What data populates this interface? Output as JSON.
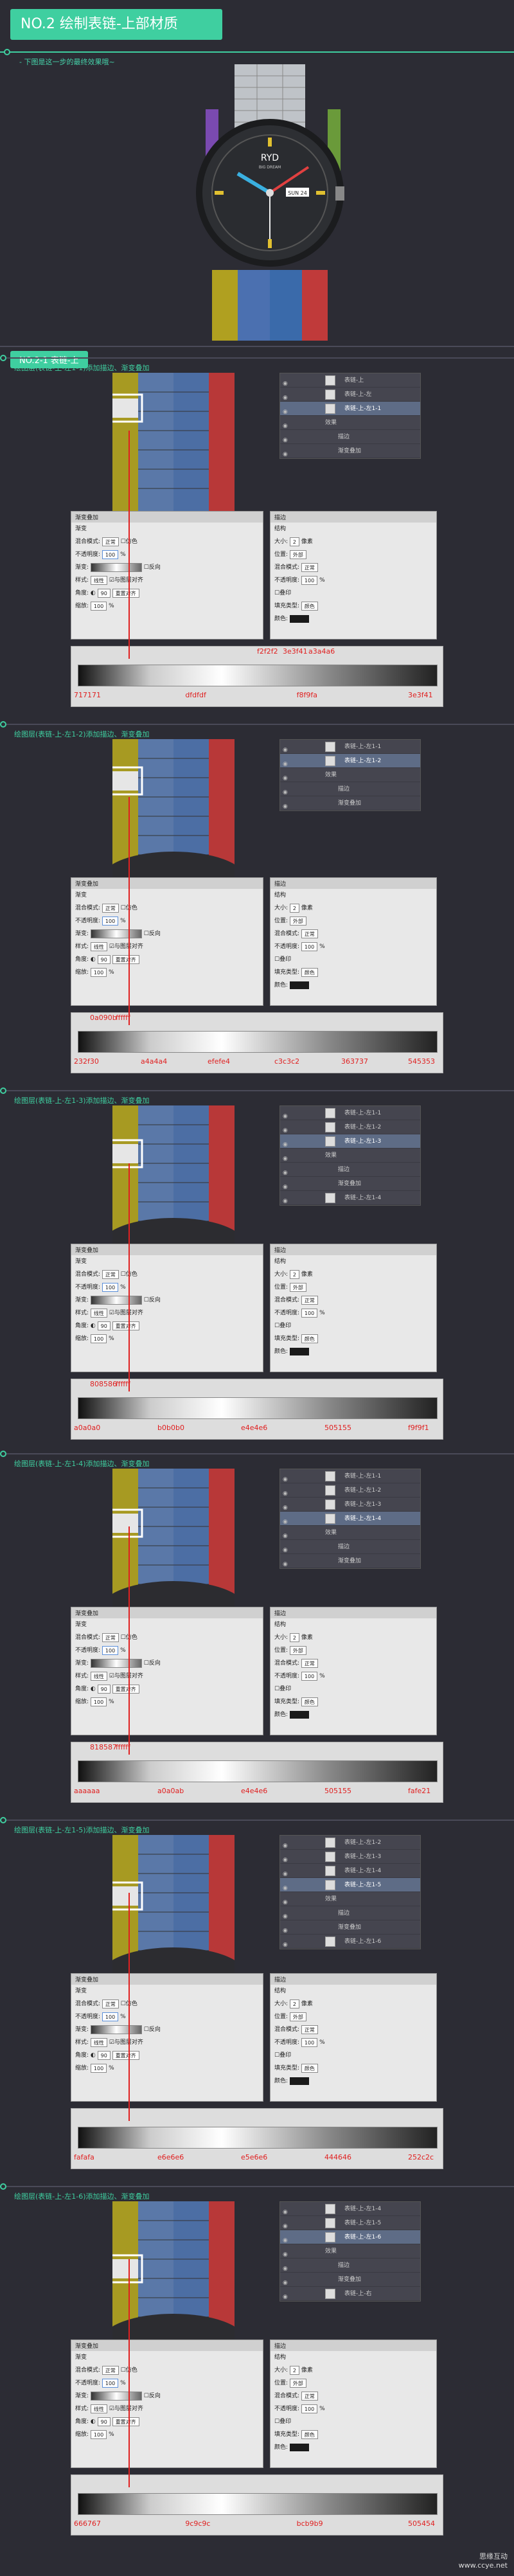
{
  "header": {
    "title": "NO.2 绘制表链-上部材质",
    "subtitle": "- 下图是这一步的最终效果哦~"
  },
  "section": {
    "tag": "NO.2-1 表链-上"
  },
  "watch": {
    "brand": "RYD",
    "sub": "BIG DREAM",
    "date": "SUN 24"
  },
  "steps": [
    {
      "label": "绘图层(表链-上-左1-1)添加描边、渐变叠加",
      "layers": [
        "表链-上",
        "表链-上-左",
        "表链-上-左1-1",
        "效果",
        "描边",
        "渐变叠加"
      ],
      "stopsTop": [
        "f2f2f2",
        "3e3f41",
        "a3a4a6"
      ],
      "stopsBottom": [
        "717171",
        "dfdfdf",
        "f8f9fa",
        "3e3f41"
      ]
    },
    {
      "label": "绘图层(表链-上-左1-2)添加描边、渐变叠加",
      "layers": [
        "表链-上-左1-1",
        "表链-上-左1-2",
        "效果",
        "描边",
        "渐变叠加"
      ],
      "stopsTop": [
        "0a090b",
        "ffffff"
      ],
      "stopsBottom": [
        "232f30",
        "a4a4a4",
        "efefe4",
        "c3c3c2",
        "363737",
        "545353"
      ]
    },
    {
      "label": "绘图层(表链-上-左1-3)添加描边、渐变叠加",
      "layers": [
        "表链-上-左1-1",
        "表链-上-左1-2",
        "表链-上-左1-3",
        "效果",
        "描边",
        "渐变叠加",
        "表链-上-左1-4"
      ],
      "stopsTop": [
        "808586",
        "ffffff"
      ],
      "stopsBottom": [
        "a0a0a0",
        "b0b0b0",
        "e4e4e6",
        "505155",
        "f9f9f1"
      ]
    },
    {
      "label": "绘图层(表链-上-左1-4)添加描边、渐变叠加",
      "layers": [
        "表链-上-左1-1",
        "表链-上-左1-2",
        "表链-上-左1-3",
        "表链-上-左1-4",
        "效果",
        "描边",
        "渐变叠加"
      ],
      "stopsTop": [
        "818587",
        "ffffff"
      ],
      "stopsBottom": [
        "aaaaaa",
        "a0a0ab",
        "e4e4e6",
        "505155",
        "fafe21"
      ]
    },
    {
      "label": "绘图层(表链-上-左1-5)添加描边、渐变叠加",
      "layers": [
        "表链-上-左1-2",
        "表链-上-左1-3",
        "表链-上-左1-4",
        "表链-上-左1-5",
        "效果",
        "描边",
        "渐变叠加",
        "表链-上-左1-6"
      ],
      "stopsTop": [],
      "stopsBottom": [
        "fafafa",
        "e6e6e6",
        "e5e6e6",
        "444646",
        "252c2c"
      ]
    },
    {
      "label": "绘图层(表链-上-左1-6)添加描边、渐变叠加",
      "layers": [
        "表链-上-左1-4",
        "表链-上-左1-5",
        "表链-上-左1-6",
        "效果",
        "描边",
        "渐变叠加",
        "表链-上-右"
      ],
      "stopsTop": [],
      "stopsBottom": [
        "666767",
        "9c9c9c",
        "bcb9b9",
        "505454"
      ]
    }
  ],
  "panel": {
    "grad_title": "渐变叠加",
    "grad_sub": "渐变",
    "blend": "混合模式:",
    "blend_val": "正常",
    "dither": "仿色",
    "opacity": "不透明度:",
    "op_val": "100",
    "gradient": "渐变:",
    "reverse": "反向",
    "style": "样式:",
    "style_val": "线性",
    "align": "与图层对齐",
    "angle": "角度:",
    "angle_val": "90",
    "reset": "重置对齐",
    "scale": "缩放:",
    "scale_val": "100",
    "stroke_title": "描边",
    "stroke_sub": "结构",
    "size": "大小:",
    "size_val": "2",
    "px": "像素",
    "pos": "位置:",
    "pos_val": "外部",
    "smode": "混合模式:",
    "sop": "不透明度:",
    "overprint": "叠印",
    "filltype": "填充类型:",
    "fill_val": "颜色",
    "color": "颜色:"
  },
  "footer": {
    "site": "思缘互动",
    "url": "www.ccye.net"
  }
}
